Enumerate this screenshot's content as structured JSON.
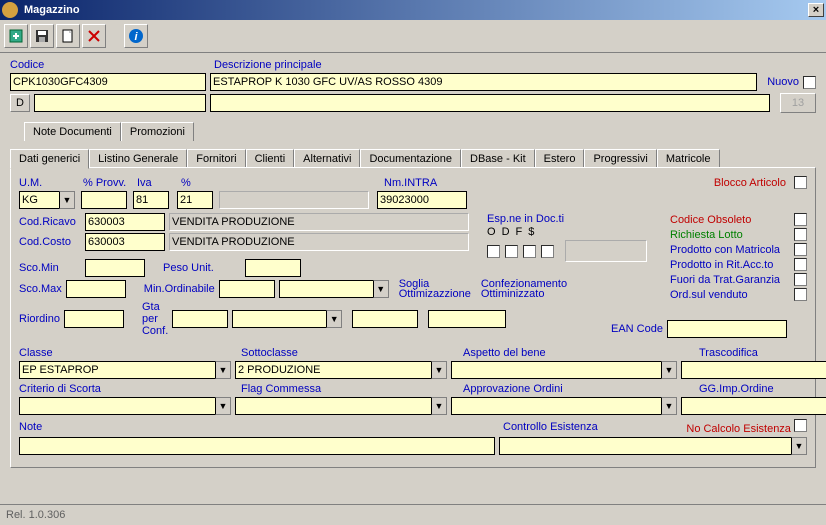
{
  "window": {
    "title": "Magazzino"
  },
  "toolbar": {
    "btn1": "export",
    "btn2": "save",
    "btn3": "new",
    "btn4": "delete",
    "btn5": "info"
  },
  "header": {
    "codice_label": "Codice",
    "codice_value": "CPK1030GFC4309",
    "descr_label": "Descrizione principale",
    "descr_value": "ESTAPROP K 1030 GFC UV/AS ROSSO 4309",
    "nuovo_label": "Nuovo",
    "d_button": "D",
    "nuovo_btn": "13"
  },
  "tabs_row1": [
    "Note Documenti",
    "Promozioni"
  ],
  "tabs_row2": [
    "Dati generici",
    "Listino Generale",
    "Fornitori",
    "Clienti",
    "Alternativi",
    "Documentazione",
    "DBase - Kit",
    "Estero",
    "Progressivi",
    "Matricole"
  ],
  "active_tab": "Dati generici",
  "form": {
    "um_label": "U.M.",
    "um_value": "KG",
    "provv_label": "% Provv.",
    "provv_value": "",
    "iva_label": "Iva",
    "iva_value": "81",
    "pct_label": "%",
    "pct_value": "21",
    "pct_desc": "",
    "nmintra_label": "Nm.INTRA",
    "nmintra_value": "39023000",
    "blocco_label": "Blocco Articolo",
    "codricavo_label": "Cod.Ricavo",
    "codricavo_value": "630003",
    "codricavo_desc": "VENDITA PRODUZIONE",
    "codcosto_label": "Cod.Costo",
    "codcosto_value": "630003",
    "codcosto_desc": "VENDITA PRODUZIONE",
    "esp_label": "Esp.ne in Doc.ti",
    "esp_cols": [
      "O",
      "D",
      "F",
      "$"
    ],
    "flags": {
      "obsoleto": "Codice Obsoleto",
      "lotto": "Richiesta Lotto",
      "matricola": "Prodotto con Matricola",
      "ritacc": "Prodotto in Rit.Acc.to",
      "garanzia": "Fuori da Trat.Garanzia",
      "venduto": "Ord.sul venduto"
    },
    "scomin_label": "Sco.Min",
    "scomin_value": "",
    "scomax_label": "Sco.Max",
    "scomax_value": "",
    "riordino_label": "Riordino",
    "riordino_value": "",
    "pesounit_label": "Peso Unit.",
    "pesounit_value": "",
    "minord_label": "Min.Ordinabile",
    "minord_value": "",
    "minord_value2": "",
    "gtaconf_label": "Gta per Conf.",
    "gtaconf_value": "",
    "gtaconf_value2": "",
    "soglia_label": "Soglia Ottimizazzione",
    "soglia_value": "",
    "confez_label": "Confezionamento Ottiminizzato",
    "confez_value": "",
    "ean_label": "EAN Code",
    "ean_value": "",
    "classe_label": "Classe",
    "classe_value": "EP ESTAPROP",
    "sottoclasse_label": "Sottoclasse",
    "sottoclasse_value": "2 PRODUZIONE",
    "aspetto_label": "Aspetto del bene",
    "aspetto_value": "",
    "trascod_label": "Trascodifica",
    "trascod_value": "",
    "critscorta_label": "Criterio di Scorta",
    "critscorta_value": "",
    "flagcomm_label": "Flag Commessa",
    "flagcomm_value": "",
    "approv_label": "Approvazione Ordini",
    "approv_value": "",
    "ggimp_label": "GG.Imp.Ordine",
    "ggimp_value": "",
    "note_label": "Note",
    "note_value": "",
    "controllo_label": "Controllo Esistenza",
    "controllo_value": "",
    "nocalc_label": "No Calcolo Esistenza"
  },
  "footer": {
    "version": "Rel. 1.0.306"
  }
}
